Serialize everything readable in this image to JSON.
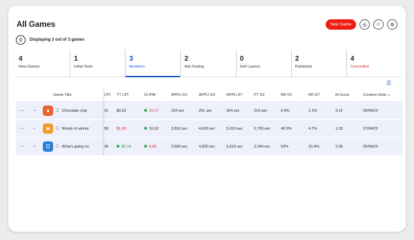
{
  "header": {
    "title": "All Games",
    "new_game_label": "New Game"
  },
  "display": {
    "text": "Displaying 3 out of 3 games"
  },
  "tabs": [
    {
      "num": "4",
      "label": "New Games"
    },
    {
      "num": "1",
      "label": "Initial Tests"
    },
    {
      "num": "3",
      "label": "Iterations"
    },
    {
      "num": "2",
      "label": "Adv.Testing"
    },
    {
      "num": "0",
      "label": "Soft Launch"
    },
    {
      "num": "2",
      "label": "Published"
    },
    {
      "num": "4",
      "label": "Concluded"
    }
  ],
  "table": {
    "columns": [
      "Game Title",
      "CPI",
      "TT CPI",
      "IS IPM",
      "APPU D1",
      "APPU D3",
      "APPU D7",
      "PT D0",
      "RR D1",
      "RR D7",
      "M.Score",
      "Creation Date"
    ],
    "rows": [
      {
        "title": "Chocolate chip",
        "cpi": "31",
        "tt_cpi": "$0.62",
        "is_ipm": "10.17",
        "appu_d1": "234 sec",
        "appu_d3": "251 sec",
        "appu_d7": "264 sec",
        "pt_d0": "214 sec",
        "rr_d1": "9.9%",
        "rr_d7": "1.2%",
        "mscore": "4.12",
        "date": "29/04/23"
      },
      {
        "title": "Words of winner",
        "cpi": "58",
        "tt_cpi": "$1.50",
        "is_ipm": "16.62",
        "appu_d1": "3,810 sec",
        "appu_d3": "4,600 sec",
        "appu_d7": "5,010 sec",
        "pt_d0": "2,700 sec",
        "rr_d1": "40.9%",
        "rr_d7": "4.7%",
        "mscore": "1.33",
        "date": "27/04/23"
      },
      {
        "title": "What's going on",
        "cpi": "36",
        "tt_cpi": "$0.19",
        "is_ipm": "6.95",
        "appu_d1": "3,550 sec",
        "appu_d3": "4,820 sec",
        "appu_d7": "5,510 sec",
        "pt_d0": "2,240 sec",
        "rr_d1": "52%",
        "rr_d7": "15.4%",
        "mscore": "2.35",
        "date": "25/04/23"
      }
    ]
  },
  "colors": {
    "accent": "#1a55c8",
    "new_game": "#ee1c13",
    "danger": "#e02020",
    "success": "#2aa84a"
  }
}
